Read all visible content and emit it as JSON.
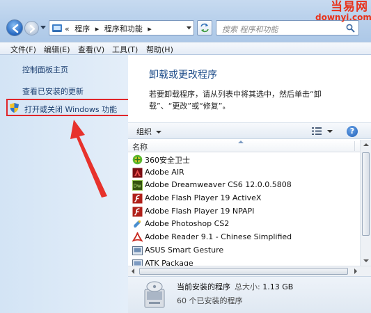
{
  "address": {
    "crumbs": [
      "«",
      "程序",
      "▸",
      "程序和功能",
      "▸"
    ]
  },
  "search": {
    "placeholder": "搜索 程序和功能"
  },
  "watermark": {
    "line1": "当易网",
    "line2": "downyi.com"
  },
  "menu": [
    "文件(F)",
    "编辑(E)",
    "查看(V)",
    "工具(T)",
    "帮助(H)"
  ],
  "navpane": {
    "home": "控制面板主页",
    "updates": "查看已安装的更新",
    "windows_features": "打开或关闭 Windows 功能"
  },
  "main": {
    "title": "卸载或更改程序",
    "description": "若要卸载程序，请从列表中将其选中，然后单击“卸载”、“更改”或“修复”。",
    "organize": "组织",
    "help": "?"
  },
  "list": {
    "column_name": "名称",
    "items": [
      {
        "name": "360安全卫士",
        "icon": "360-icon",
        "color": "#4caf28"
      },
      {
        "name": "Adobe AIR",
        "icon": "adobe-air-icon",
        "color": "#b4131e"
      },
      {
        "name": "Adobe Dreamweaver CS6 12.0.0.5808",
        "icon": "dreamweaver-icon",
        "color": "#3f6b1f"
      },
      {
        "name": "Adobe Flash Player 19 ActiveX",
        "icon": "flash-icon",
        "color": "#c8281e"
      },
      {
        "name": "Adobe Flash Player 19 NPAPI",
        "icon": "flash-icon",
        "color": "#c8281e"
      },
      {
        "name": "Adobe Photoshop CS2",
        "icon": "photoshop-icon",
        "color": "#2a6fb0"
      },
      {
        "name": "Adobe Reader 9.1 - Chinese Simplified",
        "icon": "reader-icon",
        "color": "#c8281e"
      },
      {
        "name": "ASUS Smart Gesture",
        "icon": "asus-icon",
        "color": "#5a6f88"
      },
      {
        "name": "ATK Package",
        "icon": "atk-icon",
        "color": "#5a6f88"
      }
    ]
  },
  "details": {
    "title": "当前安装的程序",
    "size_label": "总大小:",
    "size_value": "1.13 GB",
    "count": "60 个已安装的程序"
  }
}
